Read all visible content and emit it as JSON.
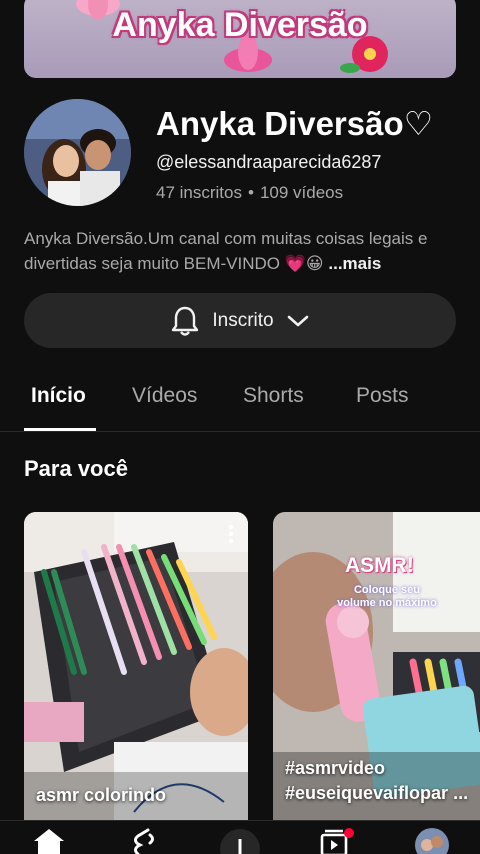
{
  "banner": {
    "title": "Anyka Diversão"
  },
  "channel": {
    "name": "Anyka Diversão♡",
    "handle": "@elessandraaparecida6287",
    "subscribers": "47 inscritos",
    "separator": "•",
    "videos": "109 vídeos",
    "description": "Anyka Diversão.Um canal com muitas coisas legais e divertidas seja muito BEM-VINDO 💗😀",
    "more_label": "...mais"
  },
  "subscribe_button": {
    "label": "Inscrito"
  },
  "tabs": [
    {
      "label": "Início"
    },
    {
      "label": "Vídeos"
    },
    {
      "label": "Shorts"
    },
    {
      "label": "Posts"
    }
  ],
  "section": {
    "title": "Para você"
  },
  "cards": [
    {
      "label": "asmr colorindo"
    },
    {
      "overlay_title": "ASMR!",
      "overlay_subtitle": "Coloque seu volume no máximo",
      "label_line1": "#asmrvideo",
      "label_line2": "#euseiquevaiflopar ..."
    }
  ],
  "colors": {
    "background": "#0f0f0f",
    "button_bg": "#272727",
    "notification_dot": "#ff0033"
  },
  "icons": [
    "bell-icon",
    "chevron-down-icon",
    "home-icon",
    "shorts-icon",
    "create-icon",
    "subscriptions-icon",
    "avatar"
  ]
}
